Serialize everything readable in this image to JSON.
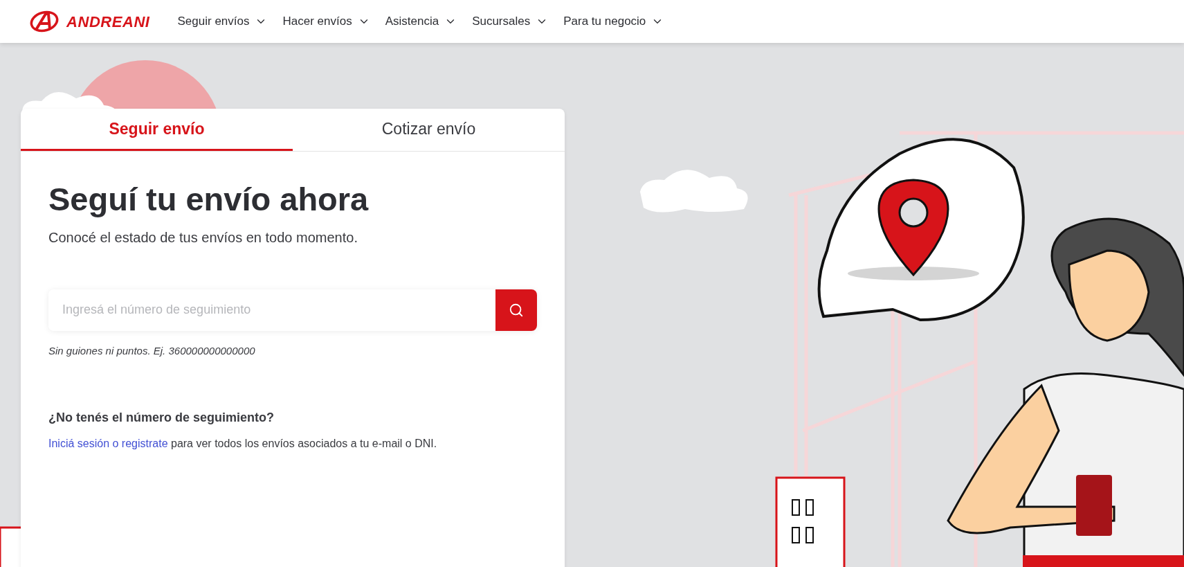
{
  "header": {
    "logo_text": "ANDREANI",
    "nav": [
      {
        "label": "Seguir envíos"
      },
      {
        "label": "Hacer envíos"
      },
      {
        "label": "Asistencia"
      },
      {
        "label": "Sucursales"
      },
      {
        "label": "Para tu negocio"
      }
    ]
  },
  "card": {
    "tabs": [
      {
        "label": "Seguir envío",
        "selected": true
      },
      {
        "label": "Cotizar envío",
        "selected": false
      }
    ],
    "title": "Seguí tu envío ahora",
    "subtitle": "Conocé el estado de tus envíos en todo momento.",
    "search": {
      "placeholder": "Ingresá el número de seguimiento"
    },
    "hint": "Sin guiones ni puntos. Ej. 360000000000000",
    "question": "¿No tenés el número de seguimiento?",
    "login_link": "Iniciá sesión o registrate",
    "login_text": "para ver todos los envíos asociados a tu e-mail o DNI."
  }
}
